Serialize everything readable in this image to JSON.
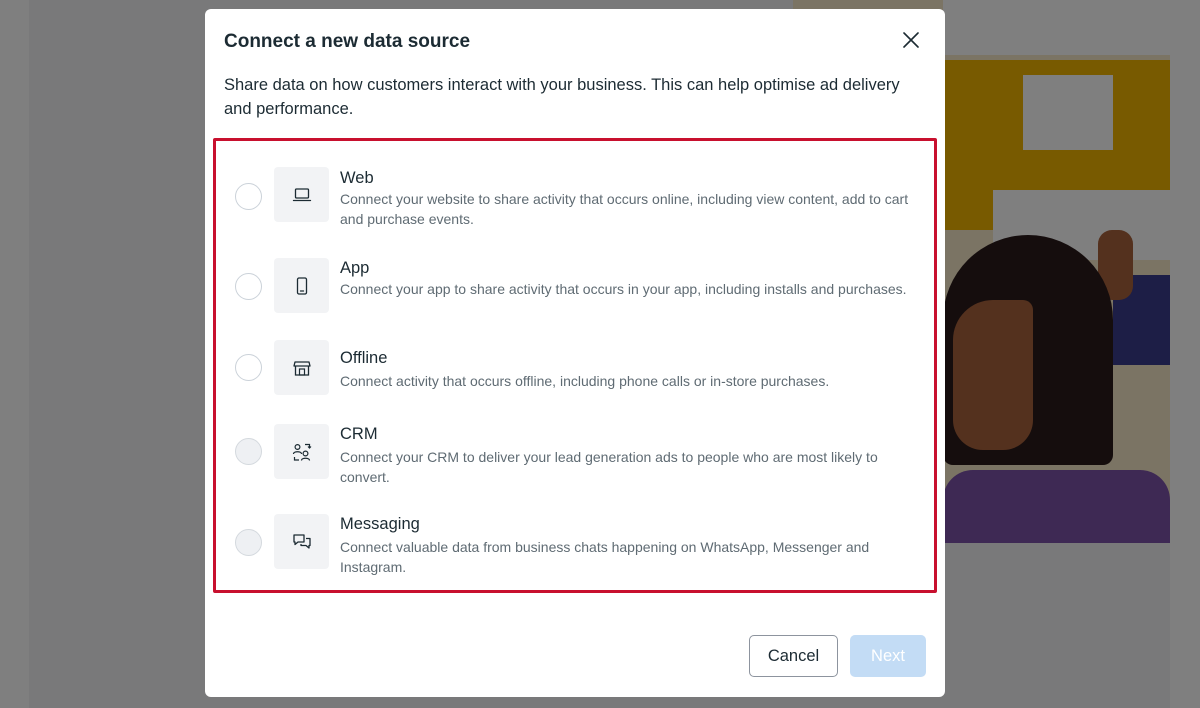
{
  "dialog": {
    "title": "Connect a new data source",
    "description": "Share data on how customers interact with your business. This can help optimise ad delivery and performance.",
    "close_icon": "close-icon"
  },
  "options": [
    {
      "icon": "laptop-icon",
      "title": "Web",
      "description": "Connect your website to share activity that occurs online, including view content, add to cart and purchase events.",
      "selected": false,
      "disabled": false
    },
    {
      "icon": "mobile-phone-icon",
      "title": "App",
      "description": "Connect your app to share activity that occurs in your app, including installs and purchases.",
      "selected": false,
      "disabled": false
    },
    {
      "icon": "storefront-icon",
      "title": "Offline",
      "description": "Connect activity that occurs offline, including phone calls or in-store purchases.",
      "selected": false,
      "disabled": false
    },
    {
      "icon": "people-sync-icon",
      "title": "CRM",
      "description": "Connect your CRM to deliver your lead generation ads to people who are most likely to convert.",
      "selected": false,
      "disabled": true
    },
    {
      "icon": "chat-bubbles-icon",
      "title": "Messaging",
      "description": "Connect valuable data from business chats happening on WhatsApp, Messenger and Instagram.",
      "selected": false,
      "disabled": true
    }
  ],
  "footer": {
    "cancel_label": "Cancel",
    "next_label": "Next",
    "next_disabled": true
  },
  "colors": {
    "highlight_border": "#c8102e",
    "text_primary": "#1c2b33",
    "text_secondary": "#5f6b73",
    "next_disabled_bg": "#c3dcf5"
  }
}
